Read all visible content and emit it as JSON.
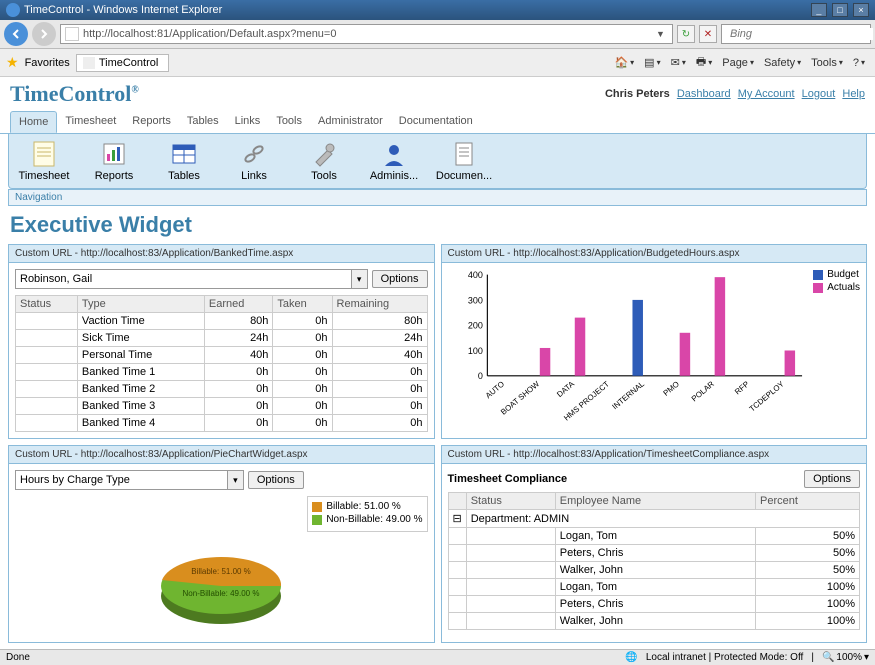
{
  "window": {
    "title": "TimeControl - Windows Internet Explorer"
  },
  "address": "http://localhost:81/Application/Default.aspx?menu=0",
  "search_placeholder": "Bing",
  "favorites_label": "Favorites",
  "tab_title": "TimeControl",
  "ie_tools": [
    "Page",
    "Safety",
    "Tools"
  ],
  "app": {
    "name": "TimeControl",
    "reg": "®"
  },
  "user": {
    "name": "Chris Peters",
    "links": [
      "Dashboard",
      "My Account",
      "Logout",
      "Help"
    ]
  },
  "menu": [
    "Home",
    "Timesheet",
    "Reports",
    "Tables",
    "Links",
    "Tools",
    "Administrator",
    "Documentation"
  ],
  "ribbon": [
    "Timesheet",
    "Reports",
    "Tables",
    "Links",
    "Tools",
    "Adminis...",
    "Documen..."
  ],
  "nav_label": "Navigation",
  "page_title": "Executive Widget",
  "banked": {
    "header": "Custom URL - http://localhost:83/Application/BankedTime.aspx",
    "options": "Options",
    "employee": "Robinson, Gail",
    "cols": [
      "Status",
      "Type",
      "Earned",
      "Taken",
      "Remaining"
    ],
    "rows": [
      {
        "status": "green",
        "type": "Vaction Time",
        "earned": "80h",
        "taken": "0h",
        "remaining": "80h"
      },
      {
        "status": "green",
        "type": "Sick Time",
        "earned": "24h",
        "taken": "0h",
        "remaining": "24h"
      },
      {
        "status": "green",
        "type": "Personal Time",
        "earned": "40h",
        "taken": "0h",
        "remaining": "40h"
      },
      {
        "status": "red",
        "type": "Banked Time 1",
        "earned": "0h",
        "taken": "0h",
        "remaining": "0h"
      },
      {
        "status": "red",
        "type": "Banked Time 2",
        "earned": "0h",
        "taken": "0h",
        "remaining": "0h"
      },
      {
        "status": "red",
        "type": "Banked Time 3",
        "earned": "0h",
        "taken": "0h",
        "remaining": "0h"
      },
      {
        "status": "red",
        "type": "Banked Time 4",
        "earned": "0h",
        "taken": "0h",
        "remaining": "0h"
      }
    ]
  },
  "budget": {
    "header": "Custom URL - http://localhost:83/Application/BudgetedHours.aspx",
    "legend": [
      {
        "label": "Budget",
        "color": "#2e5cb8"
      },
      {
        "label": "Actuals",
        "color": "#d946a8"
      }
    ]
  },
  "pie": {
    "header": "Custom URL - http://localhost:83/Application/PieChartWidget.aspx",
    "options": "Options",
    "dropdown": "Hours by Charge Type",
    "legend": [
      {
        "label": "Billable: 51.00 %",
        "color": "#d98e1e"
      },
      {
        "label": "Non-Billable: 49.00 %",
        "color": "#6fb530"
      }
    ],
    "slice_billable": "Billable: 51.00 %",
    "slice_nonbillable": "Non-Billable: 49.00 %"
  },
  "compliance": {
    "header": "Custom URL - http://localhost:83/Application/TimesheetCompliance.aspx",
    "title": "Timesheet Compliance",
    "options": "Options",
    "cols": [
      "Status",
      "Employee Name",
      "Percent"
    ],
    "dept": "Department: ADMIN",
    "rows": [
      {
        "status": "yellow",
        "name": "Logan, Tom",
        "pct": "50%"
      },
      {
        "status": "yellow",
        "name": "Peters, Chris",
        "pct": "50%"
      },
      {
        "status": "yellow",
        "name": "Walker, John",
        "pct": "50%"
      },
      {
        "status": "green",
        "name": "Logan, Tom",
        "pct": "100%"
      },
      {
        "status": "green",
        "name": "Peters, Chris",
        "pct": "100%"
      },
      {
        "status": "green",
        "name": "Walker, John",
        "pct": "100%"
      }
    ]
  },
  "status": {
    "left": "Done",
    "mode": "Local intranet | Protected Mode: Off",
    "zoom": "100%"
  },
  "chart_data": [
    {
      "type": "bar",
      "title": "Budgeted Hours",
      "legend": [
        "Budget",
        "Actuals"
      ],
      "categories": [
        "AUTO",
        "BOAT SHOW",
        "DATA",
        "HMS PROJECT",
        "INTERNAL",
        "PMO",
        "POLAR",
        "RFP",
        "TCDEPLOY"
      ],
      "series": [
        {
          "name": "Budget",
          "values": [
            0,
            0,
            0,
            0,
            300,
            0,
            0,
            0,
            0
          ]
        },
        {
          "name": "Actuals",
          "values": [
            0,
            110,
            230,
            0,
            0,
            170,
            390,
            0,
            100
          ]
        }
      ],
      "ylim": [
        0,
        400
      ],
      "yticks": [
        0,
        100,
        200,
        300,
        400
      ]
    },
    {
      "type": "pie",
      "title": "Hours by Charge Type",
      "categories": [
        "Billable",
        "Non-Billable"
      ],
      "values": [
        51.0,
        49.0
      ]
    }
  ]
}
